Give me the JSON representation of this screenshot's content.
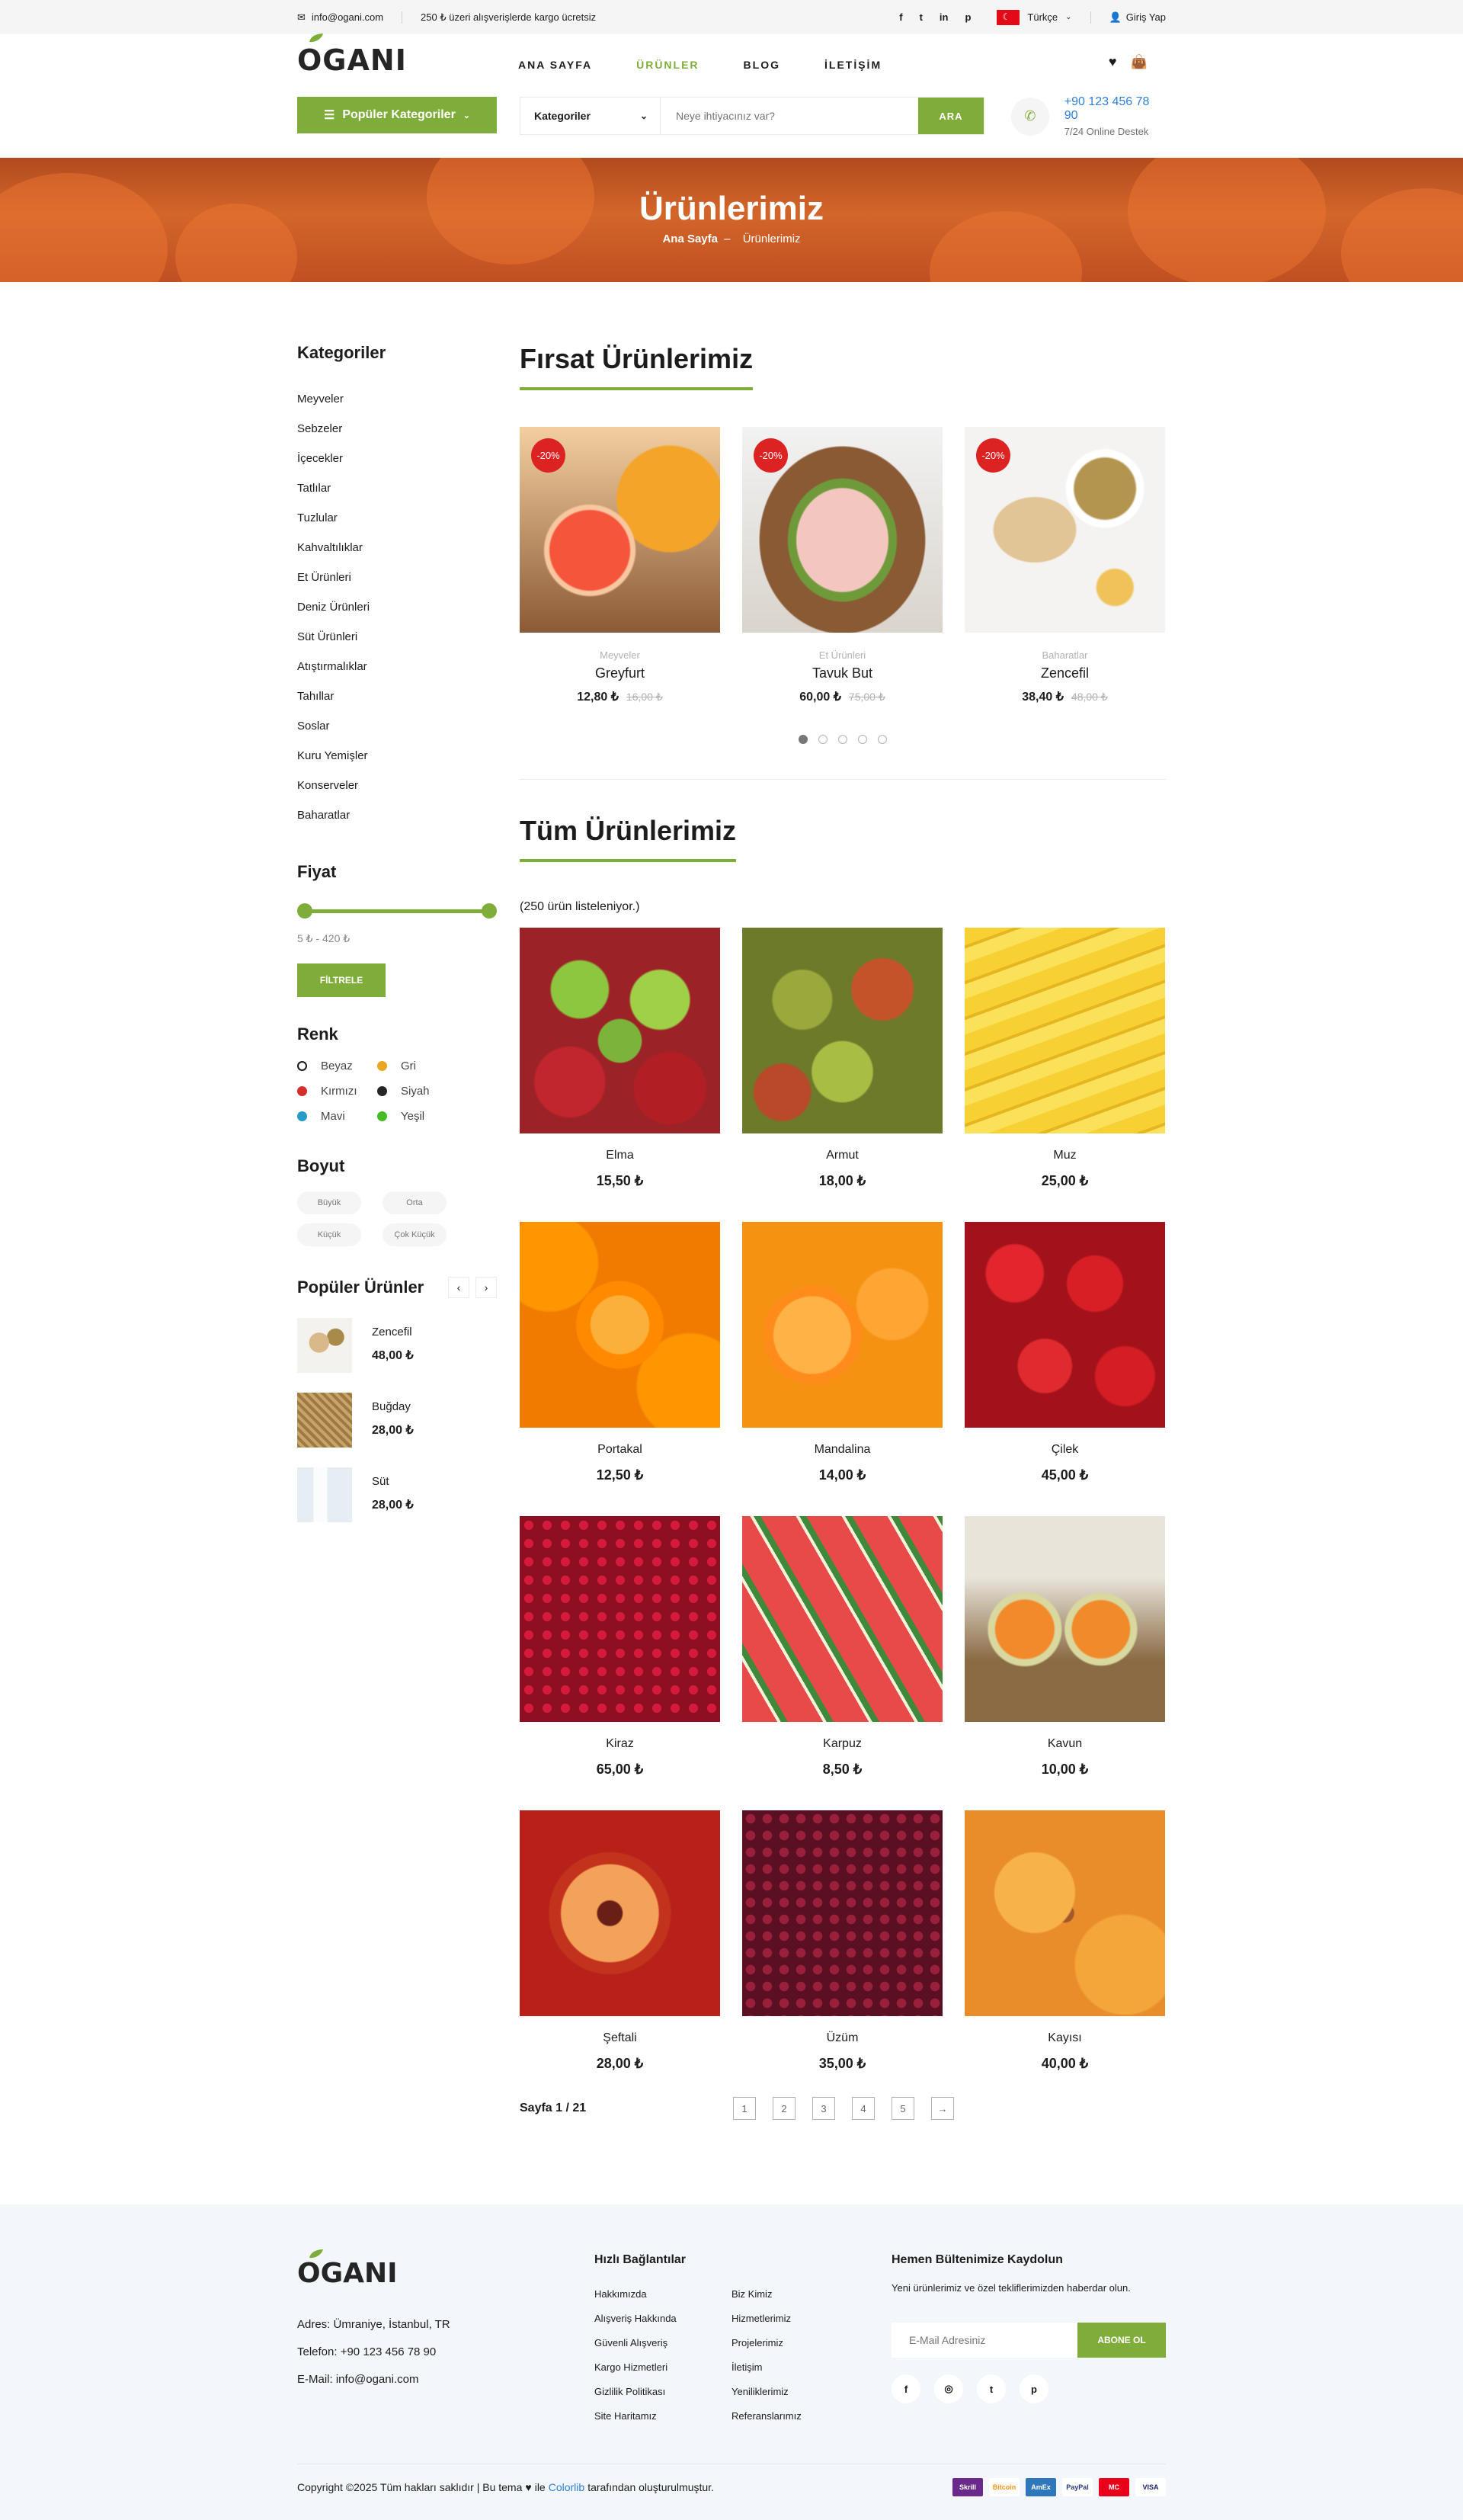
{
  "topbar": {
    "email": "info@ogani.com",
    "shipping": "250 ₺ üzeri alışverişlerde kargo ücretsiz",
    "language": "Türkçe",
    "login": "Giriş Yap",
    "social": [
      {
        "icon": "facebook-icon",
        "glyph": "f"
      },
      {
        "icon": "twitter-icon",
        "glyph": "t"
      },
      {
        "icon": "linkedin-icon",
        "glyph": "in"
      },
      {
        "icon": "pinterest-icon",
        "glyph": "p"
      }
    ]
  },
  "header": {
    "logo": "OGANI",
    "nav": [
      "ANA SAYFA",
      "ÜRÜNLER",
      "BLOG",
      "İLETİŞİM"
    ],
    "active_nav": 1,
    "categories_button": "Popüler Kategoriler",
    "search": {
      "category": "Kategoriler",
      "placeholder": "Neye ihtiyacınız var?",
      "button": "ARA"
    },
    "phone": "+90 123 456 78 90",
    "support": "7/24 Online Destek"
  },
  "banner": {
    "title": "Ürünlerimiz",
    "home": "Ana Sayfa",
    "separator": "–",
    "current": "Ürünlerimiz"
  },
  "sidebar": {
    "categories_title": "Kategoriler",
    "categories": [
      "Meyveler",
      "Sebzeler",
      "İçecekler",
      "Tatlılar",
      "Tuzlular",
      "Kahvaltılıklar",
      "Et Ürünleri",
      "Deniz Ürünleri",
      "Süt Ürünleri",
      "Atıştırmalıklar",
      "Tahıllar",
      "Soslar",
      "Kuru Yemişler",
      "Konserveler",
      "Baharatlar"
    ],
    "price_title": "Fiyat",
    "price_range": "5 ₺ - 420 ₺",
    "filter_button": "FİLTRELE",
    "color_title": "Renk",
    "colors": [
      {
        "name": "Beyaz",
        "color": "#ffffff"
      },
      {
        "name": "Gri",
        "color": "#e9a625"
      },
      {
        "name": "Kırmızı",
        "color": "#d62d2d"
      },
      {
        "name": "Siyah",
        "color": "#252525"
      },
      {
        "name": "Mavi",
        "color": "#249bc8"
      },
      {
        "name": "Yeşil",
        "color": "#45bc23"
      }
    ],
    "size_title": "Boyut",
    "sizes": [
      "Büyük",
      "Orta",
      "Küçük",
      "Çok Küçük"
    ],
    "popular_title": "Popüler Ürünler",
    "popular": [
      {
        "name": "Zencefil",
        "price": "48,00 ₺"
      },
      {
        "name": "Buğday",
        "price": "28,00 ₺"
      },
      {
        "name": "Süt",
        "price": "28,00 ₺"
      }
    ]
  },
  "deals": {
    "title": "Fırsat Ürünlerimiz",
    "items": [
      {
        "discount": "-20%",
        "category": "Meyveler",
        "name": "Greyfurt",
        "price": "12,80 ₺",
        "old": "16,00 ₺"
      },
      {
        "discount": "-20%",
        "category": "Et Ürünleri",
        "name": "Tavuk But",
        "price": "60,00 ₺",
        "old": "75,00 ₺"
      },
      {
        "discount": "-20%",
        "category": "Baharatlar",
        "name": "Zencefil",
        "price": "38,40 ₺",
        "old": "48,00 ₺"
      }
    ]
  },
  "all": {
    "title": "Tüm Ürünlerimiz",
    "count": "(250 ürün listeleniyor.)",
    "items": [
      {
        "name": "Elma",
        "price": "15,50 ₺"
      },
      {
        "name": "Armut",
        "price": "18,00 ₺"
      },
      {
        "name": "Muz",
        "price": "25,00 ₺"
      },
      {
        "name": "Portakal",
        "price": "12,50 ₺"
      },
      {
        "name": "Mandalina",
        "price": "14,00 ₺"
      },
      {
        "name": "Çilek",
        "price": "45,00 ₺"
      },
      {
        "name": "Kiraz",
        "price": "65,00 ₺"
      },
      {
        "name": "Karpuz",
        "price": "8,50 ₺"
      },
      {
        "name": "Kavun",
        "price": "10,00 ₺"
      },
      {
        "name": "Şeftali",
        "price": "28,00 ₺"
      },
      {
        "name": "Üzüm",
        "price": "35,00 ₺"
      },
      {
        "name": "Kayısı",
        "price": "40,00 ₺"
      }
    ]
  },
  "pagination": {
    "label": "Sayfa 1 / 21",
    "pages": [
      "1",
      "2",
      "3",
      "4",
      "5",
      "→"
    ]
  },
  "footer": {
    "logo": "OGANI",
    "address": "Adres: Ümraniye, İstanbul, TR",
    "phone": "Telefon: +90 123 456 78 90",
    "email": "E-Mail: info@ogani.com",
    "links_title": "Hızlı Bağlantılar",
    "links": [
      "Hakkımızda",
      "Biz Kimiz",
      "Alışveriş Hakkında",
      "Hizmetlerimiz",
      "Güvenli Alışveriş",
      "Projelerimiz",
      "Kargo Hizmetleri",
      "İletişim",
      "Gizlilik Politikası",
      "Yeniliklerimiz",
      "Site Haritamız",
      "Referanslarımız"
    ],
    "news_title": "Hemen Bültenimize Kaydolun",
    "news_text": "Yeni ürünlerimiz ve özel tekliflerimizden haberdar olun.",
    "news_placeholder": "E-Mail Adresiniz",
    "news_button": "ABONE OL",
    "copy_before": "Copyright ©2025 Tüm hakları saklıdır | Bu tema",
    "copy_with": "ile",
    "copy_brand": "Colorlib",
    "copy_after": "tarafından oluşturulmuştur.",
    "payments": [
      "Skrill",
      "Bitcoin",
      "AmEx",
      "PayPal",
      "MC",
      "VISA"
    ]
  }
}
